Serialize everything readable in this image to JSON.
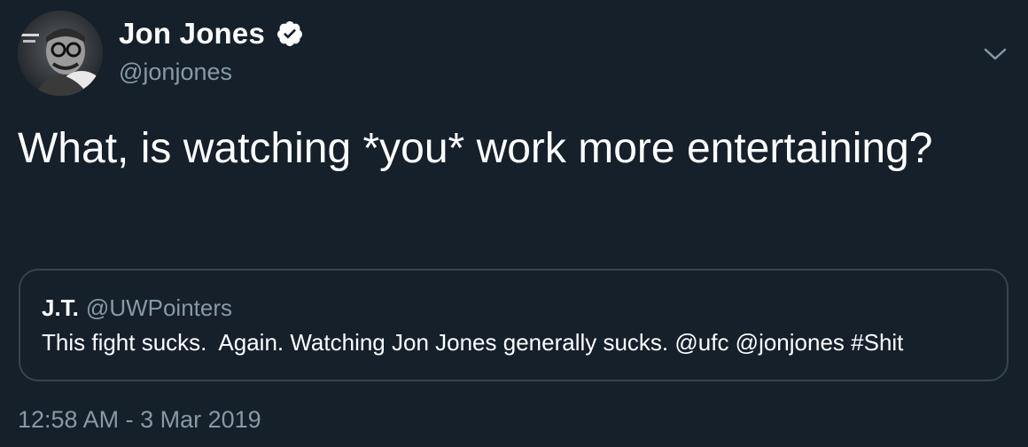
{
  "author": {
    "display_name": "Jon Jones",
    "handle": "@jonjones",
    "verified": true,
    "avatar_icon": "profile-photo"
  },
  "tweet": {
    "text": "What, is watching *you* work more entertaining?"
  },
  "quoted_tweet": {
    "display_name": "J.T.",
    "handle": "@UWPointers",
    "text": "This fight sucks.  Again. Watching Jon Jones generally sucks. @ufc @jonjones #Shit"
  },
  "timestamp": "12:58 AM - 3 Mar 2019",
  "menu_icon": "chevron-down-icon",
  "colors": {
    "background": "#15202b",
    "text": "#ffffff",
    "secondary_text": "#8899a6",
    "border": "#38444d",
    "verified_badge": "#ffffff"
  }
}
